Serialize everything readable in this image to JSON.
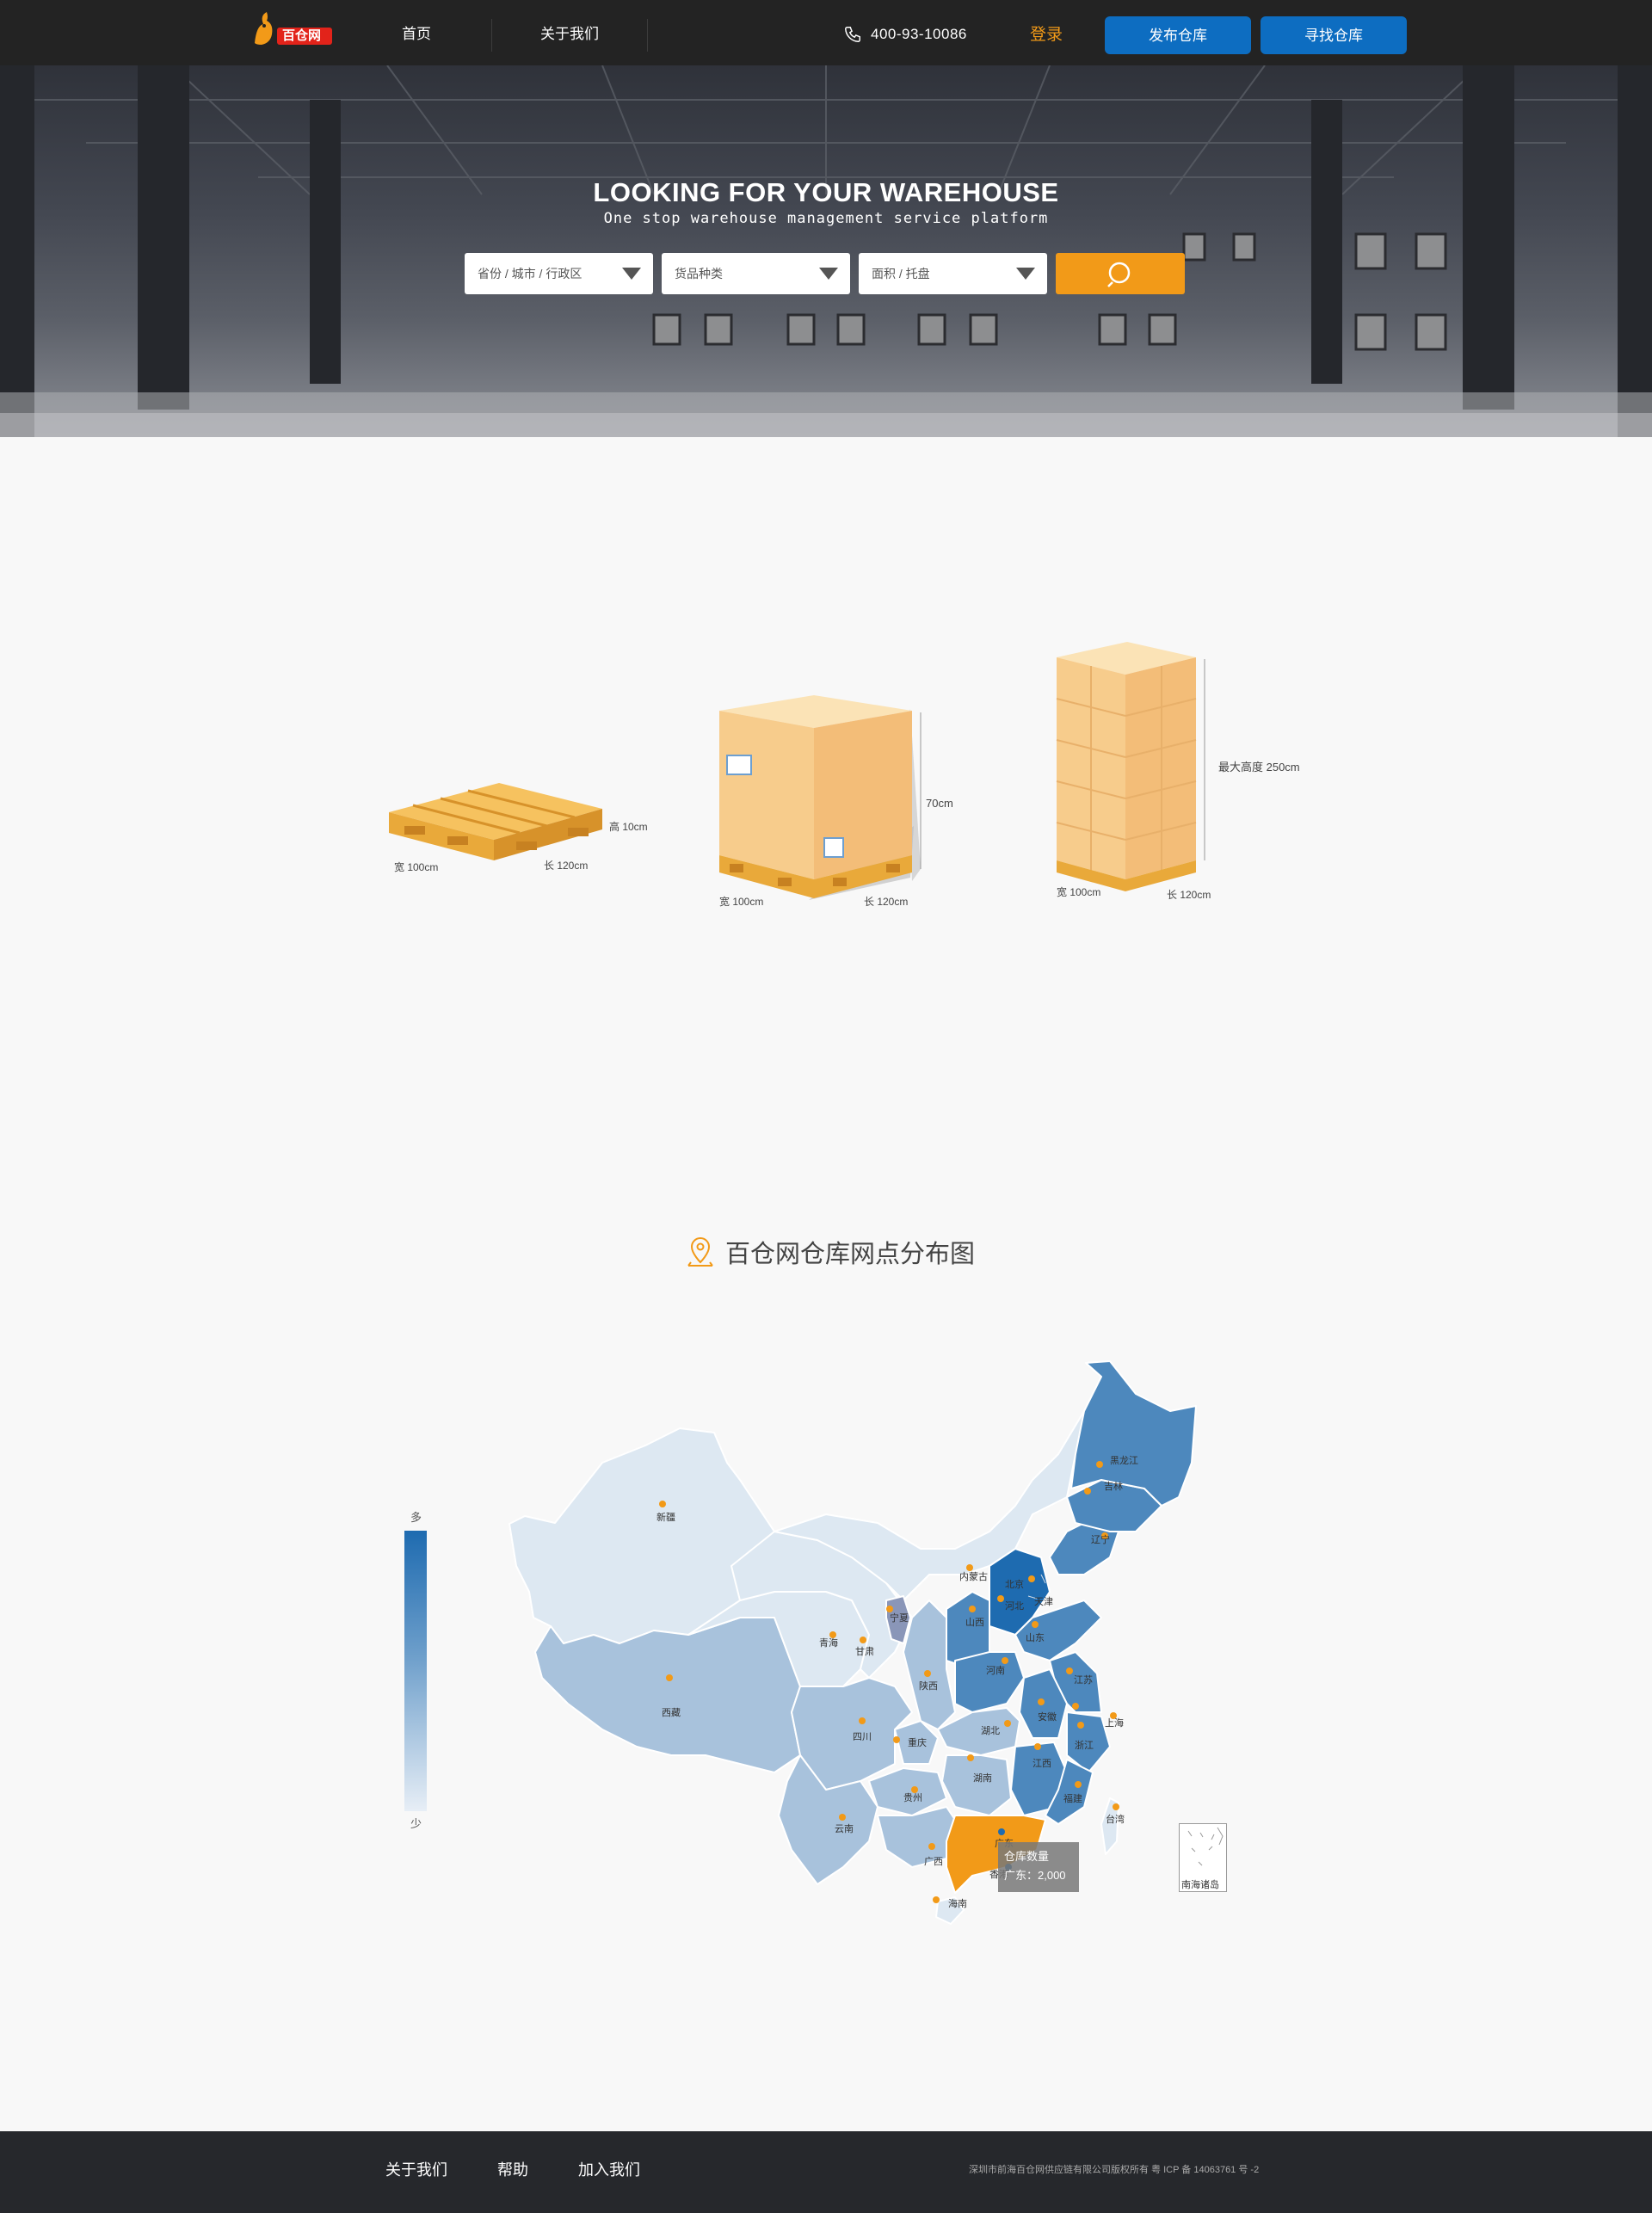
{
  "header": {
    "logo_text": "百仓网",
    "nav": [
      {
        "label": "首页"
      },
      {
        "label": "关于我们"
      }
    ],
    "phone": "400-93-10086",
    "login": "登录",
    "publish_button": "发布仓库",
    "find_button": "寻找仓库"
  },
  "hero": {
    "title": "LOOKING FOR YOUR WAREHOUSE",
    "subtitle": "One stop warehouse management service platform",
    "selects": [
      {
        "value": "省份 / 城市 / 行政区"
      },
      {
        "value": "货品种类"
      },
      {
        "value": "面积 / 托盘"
      }
    ],
    "search_icon": "search-icon"
  },
  "pallets": {
    "empty": {
      "height": "高 10cm",
      "width": "宽 100cm",
      "length": "长 120cm"
    },
    "boxed": {
      "height": "70cm",
      "width": "宽 100cm",
      "length": "长 120cm"
    },
    "stacked": {
      "height": "最大高度 250cm",
      "width": "宽 100cm",
      "length": "长 120cm"
    }
  },
  "map": {
    "title": "百仓网仓库网点分布图",
    "title_icon": "map-pin-icon",
    "legend": {
      "high": "多",
      "low": "少"
    },
    "provinces": [
      {
        "name": "黑龙江"
      },
      {
        "name": "吉林"
      },
      {
        "name": "辽宁"
      },
      {
        "name": "内蒙古"
      },
      {
        "name": "北京"
      },
      {
        "name": "天津"
      },
      {
        "name": "河北"
      },
      {
        "name": "山西"
      },
      {
        "name": "山东"
      },
      {
        "name": "河南"
      },
      {
        "name": "江苏"
      },
      {
        "name": "上海"
      },
      {
        "name": "安徽"
      },
      {
        "name": "浙江"
      },
      {
        "name": "湖北"
      },
      {
        "name": "江西"
      },
      {
        "name": "福建"
      },
      {
        "name": "台湾"
      },
      {
        "name": "湖南"
      },
      {
        "name": "广东"
      },
      {
        "name": "广西"
      },
      {
        "name": "海南"
      },
      {
        "name": "贵州"
      },
      {
        "name": "云南"
      },
      {
        "name": "重庆"
      },
      {
        "name": "四川"
      },
      {
        "name": "陕西"
      },
      {
        "name": "宁夏"
      },
      {
        "name": "甘肃"
      },
      {
        "name": "青海"
      },
      {
        "name": "西藏"
      },
      {
        "name": "新疆"
      },
      {
        "name": "香港"
      }
    ],
    "tooltip": {
      "title": "仓库数量",
      "value": "广东：2,000"
    },
    "inset_label": "南海诸岛",
    "colors": {
      "dark": "#1e6bb0",
      "mid": "#4d88bd",
      "light": "#9bbcd8",
      "pale": "#dde8f2",
      "highlight": "#f29a18",
      "ningxia": "#8a96b8"
    }
  },
  "footer": {
    "links": [
      {
        "label": "关于我们"
      },
      {
        "label": "帮助"
      },
      {
        "label": "加入我们"
      }
    ],
    "copyright": "深圳市前海百仓网供应链有限公司版权所有   粤 ICP 备 14063761 号 -2"
  }
}
